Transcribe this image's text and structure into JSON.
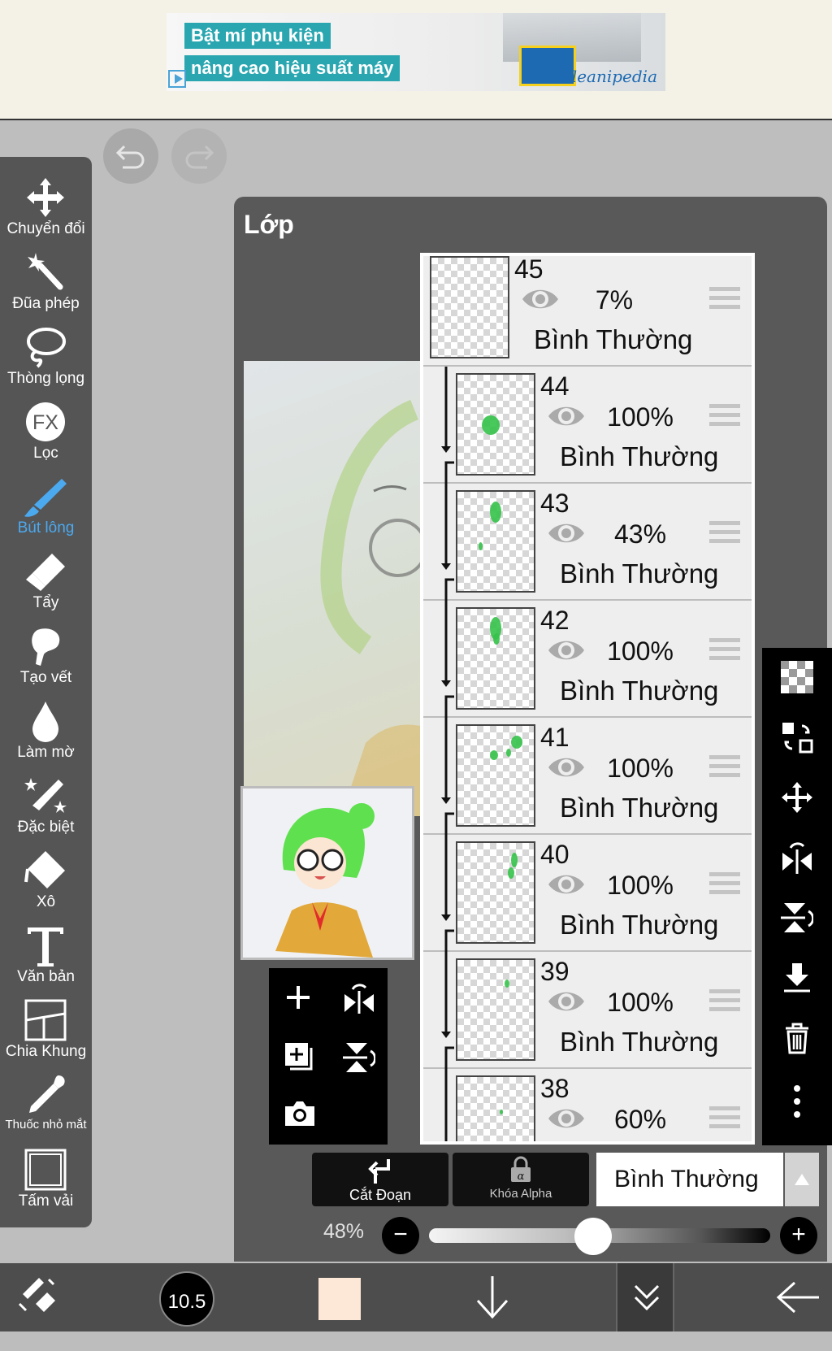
{
  "ad": {
    "line1": "Bật mí phụ kiện",
    "line2": "nâng cao hiệu suất máy",
    "brand": "Cleanipedia"
  },
  "tools": [
    {
      "label": "Chuyển đổi",
      "icon": "move-icon"
    },
    {
      "label": "Đũa phép",
      "icon": "magic-wand-icon"
    },
    {
      "label": "Thòng lọng",
      "icon": "lasso-icon"
    },
    {
      "label": "Lọc",
      "icon": "fx-icon"
    },
    {
      "label": "Bút lông",
      "icon": "brush-icon",
      "active": true
    },
    {
      "label": "Tẩy",
      "icon": "eraser-icon"
    },
    {
      "label": "Tạo vết",
      "icon": "smudge-icon"
    },
    {
      "label": "Làm mờ",
      "icon": "blur-drop-icon"
    },
    {
      "label": "Đặc biệt",
      "icon": "special-pen-icon"
    },
    {
      "label": "Xô",
      "icon": "bucket-icon"
    },
    {
      "label": "Văn bản",
      "icon": "text-icon"
    },
    {
      "label": "Chia Khung",
      "icon": "frame-divider-icon"
    },
    {
      "label": "Thuốc nhỏ mắt",
      "icon": "eyedropper-icon"
    },
    {
      "label": "Tấm vải",
      "icon": "canvas-icon"
    }
  ],
  "layer_panel": {
    "title": "Lớp",
    "layers": [
      {
        "number": "45",
        "opacity": "7%",
        "blend": "Bình Thường",
        "clipped": false
      },
      {
        "number": "44",
        "opacity": "100%",
        "blend": "Bình Thường",
        "clipped": true
      },
      {
        "number": "43",
        "opacity": "43%",
        "blend": "Bình Thường",
        "clipped": true
      },
      {
        "number": "42",
        "opacity": "100%",
        "blend": "Bình Thường",
        "clipped": true
      },
      {
        "number": "41",
        "opacity": "100%",
        "blend": "Bình Thường",
        "clipped": true
      },
      {
        "number": "40",
        "opacity": "100%",
        "blend": "Bình Thường",
        "clipped": true
      },
      {
        "number": "39",
        "opacity": "100%",
        "blend": "Bình Thường",
        "clipped": true
      },
      {
        "number": "38",
        "opacity": "60%",
        "blend": "Bình Thường",
        "clipped": true
      }
    ],
    "clip_label": "Cắt Đoạn",
    "alpha_label": "Khóa Alpha",
    "blend_mode": "Bình Thường",
    "opacity_label": "48%",
    "opacity_value": 0.48,
    "minus": "−",
    "plus": "+"
  },
  "bottom": {
    "brush_size": "10.5",
    "color": "#fde8d8"
  },
  "colors": {
    "accent": "#4ba9f0",
    "panel": "#595959",
    "toolbar": "#555555"
  }
}
